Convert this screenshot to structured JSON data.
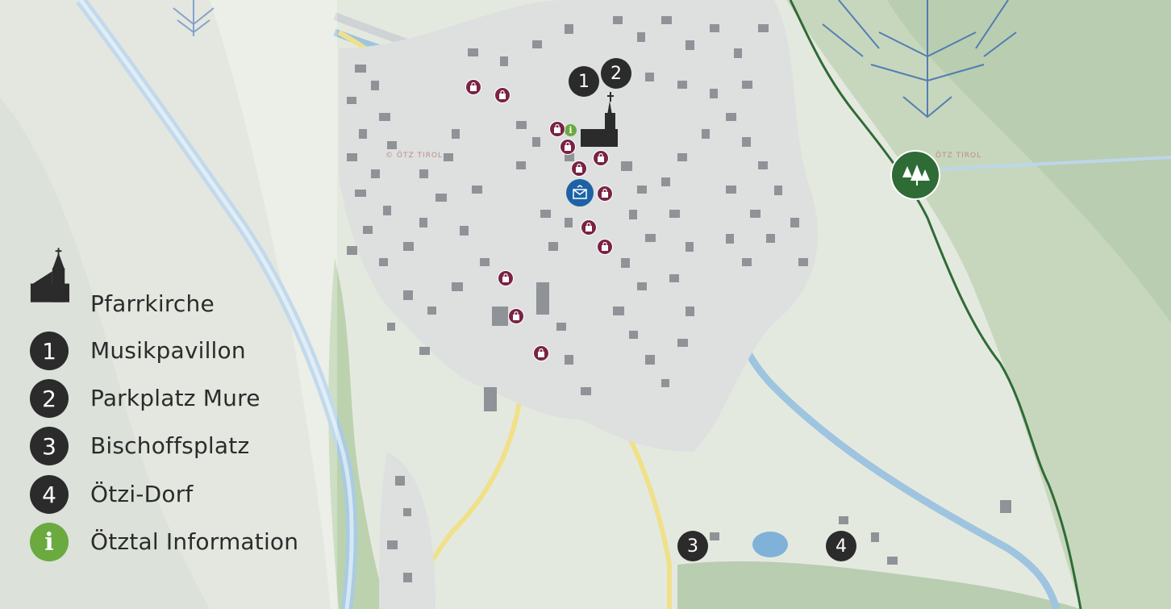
{
  "legend": {
    "items": [
      {
        "icon": "church-icon",
        "label": "Pfarrkirche"
      },
      {
        "icon": "number-badge",
        "number": "1",
        "label": "Musikpavillon"
      },
      {
        "icon": "number-badge",
        "number": "2",
        "label": "Parkplatz Mure"
      },
      {
        "icon": "number-badge",
        "number": "3",
        "label": "Bischoffsplatz"
      },
      {
        "icon": "number-badge",
        "number": "4",
        "label": "Ötzi-Dorf"
      },
      {
        "icon": "info-icon",
        "symbol": "i",
        "label": "Ötztal Information"
      }
    ]
  },
  "map": {
    "markers": [
      {
        "number": "1"
      },
      {
        "number": "2"
      },
      {
        "number": "3"
      },
      {
        "number": "4"
      }
    ],
    "watermark_text": [
      "© ÖTZ TIROL",
      "ÖTZ TIROL"
    ],
    "icons": [
      "shopping-bag-icon",
      "post-office-icon",
      "forest-trail-icon",
      "snowflake-icon",
      "church-icon",
      "info-icon"
    ]
  },
  "colors": {
    "legend_badge": "#2b2b2b",
    "info_green": "#6aaa3f",
    "shop_purple": "#7a2344",
    "post_blue": "#1d62a7",
    "forest_green": "#2f6b35",
    "river_blue": "#9ec4e0",
    "road_yellow": "#f0e08a"
  }
}
